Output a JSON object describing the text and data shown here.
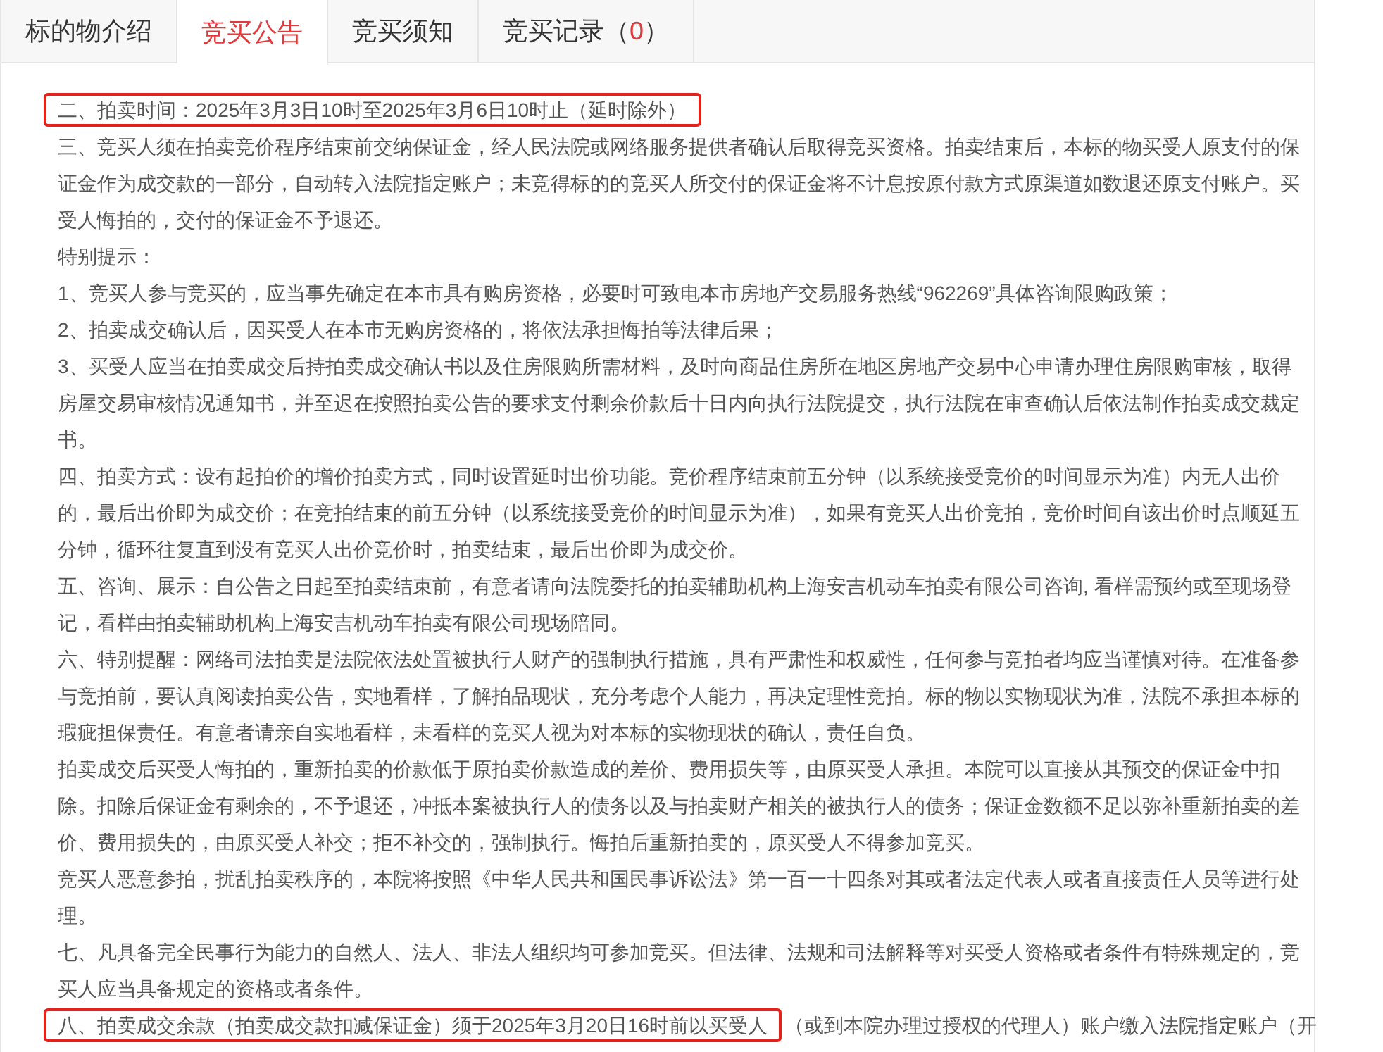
{
  "tabs": [
    {
      "label": "标的物介绍",
      "selected": false
    },
    {
      "label": "竞买公告",
      "selected": true
    },
    {
      "label": "竞买须知",
      "selected": false
    },
    {
      "label": "竞买记录（",
      "count": "0",
      "suffix": "）",
      "selected": false
    }
  ],
  "paragraphs": [
    {
      "parts": [
        {
          "text": "二、拍卖时间：2025年3月3日10时至2025年3月6日10时止（延时除外）",
          "highlighted": true
        }
      ]
    },
    {
      "parts": [
        {
          "text": "三、竞买人须在拍卖竞价程序结束前交纳保证金，经人民法院或网络服务提供者确认后取得竞买资格。拍卖结束后，本标的物买受人原支付的保证金作为成交款的一部分，自动转入法院指定账户；未竞得标的的竞买人所交付的保证金将不计息按原付款方式原渠道如数退还原支付账户。买受人悔拍的，交付的保证金不予退还。",
          "highlighted": false
        }
      ]
    },
    {
      "parts": [
        {
          "text": "特别提示：",
          "highlighted": false
        }
      ]
    },
    {
      "parts": [
        {
          "text": "1、竞买人参与竞买的，应当事先确定在本市具有购房资格，必要时可致电本市房地产交易服务热线“962269”具体咨询限购政策；",
          "highlighted": false
        }
      ]
    },
    {
      "parts": [
        {
          "text": "2、拍卖成交确认后，因买受人在本市无购房资格的，将依法承担悔拍等法律后果；",
          "highlighted": false
        }
      ]
    },
    {
      "parts": [
        {
          "text": "3、买受人应当在拍卖成交后持拍卖成交确认书以及住房限购所需材料，及时向商品住房所在地区房地产交易中心申请办理住房限购审核，取得房屋交易审核情况通知书，并至迟在按照拍卖公告的要求支付剩余价款后十日内向执行法院提交，执行法院在审查确认后依法制作拍卖成交裁定书。",
          "highlighted": false
        }
      ]
    },
    {
      "parts": [
        {
          "text": "四、拍卖方式：设有起拍价的增价拍卖方式，同时设置延时出价功能。竞价程序结束前五分钟（以系统接受竞价的时间显示为准）内无人出价的，最后出价即为成交价；在竞拍结束的前五分钟（以系统接受竞价的时间显示为准），如果有竞买人出价竞拍，竞价时间自该出价时点顺延五分钟，循环往复直到没有竞买人出价竞价时，拍卖结束，最后出价即为成交价。",
          "highlighted": false
        }
      ]
    },
    {
      "parts": [
        {
          "text": "五、咨询、展示：自公告之日起至拍卖结束前，有意者请向法院委托的拍卖辅助机构上海安吉机动车拍卖有限公司咨询, 看样需预约或至现场登记，看样由拍卖辅助机构上海安吉机动车拍卖有限公司现场陪同。",
          "highlighted": false
        }
      ]
    },
    {
      "parts": [
        {
          "text": "六、特别提醒：网络司法拍卖是法院依法处置被执行人财产的强制执行措施，具有严肃性和权威性，任何参与竞拍者均应当谨慎对待。在准备参与竞拍前，要认真阅读拍卖公告，实地看样，了解拍品现状，充分考虑个人能力，再决定理性竞拍。标的物以实物现状为准，法院不承担本标的瑕疵担保责任。有意者请亲自实地看样，未看样的竞买人视为对本标的实物现状的确认，责任自负。",
          "highlighted": false
        }
      ]
    },
    {
      "parts": [
        {
          "text": "拍卖成交后买受人悔拍的，重新拍卖的价款低于原拍卖价款造成的差价、费用损失等，由原买受人承担。本院可以直接从其预交的保证金中扣除。扣除后保证金有剩余的，不予退还，冲抵本案被执行人的债务以及与拍卖财产相关的被执行人的债务；保证金数额不足以弥补重新拍卖的差价、费用损失的，由原买受人补交；拒不补交的，强制执行。悔拍后重新拍卖的，原买受人不得参加竞买。",
          "highlighted": false
        }
      ]
    },
    {
      "parts": [
        {
          "text": "竞买人恶意参拍，扰乱拍卖秩序的，本院将按照《中华人民共和国民事诉讼法》第一百一十四条对其或者法定代表人或者直接责任人员等进行处理。",
          "highlighted": false
        }
      ]
    },
    {
      "parts": [
        {
          "text": "七、凡具备完全民事行为能力的自然人、法人、非法人组织均可参加竞买。但法律、法规和司法解释等对买受人资格或者条件有特殊规定的，竞买人应当具备规定的资格或者条件。",
          "highlighted": false
        }
      ]
    },
    {
      "parts": [
        {
          "text": "八、拍卖成交余款（拍卖成交款扣减保证金）须于2025年3月20日16时前以买受人",
          "highlighted": true
        },
        {
          "text": "（或到本院办理过授权的代理人）账户缴入法院指定账户（开",
          "highlighted": false
        }
      ]
    }
  ]
}
